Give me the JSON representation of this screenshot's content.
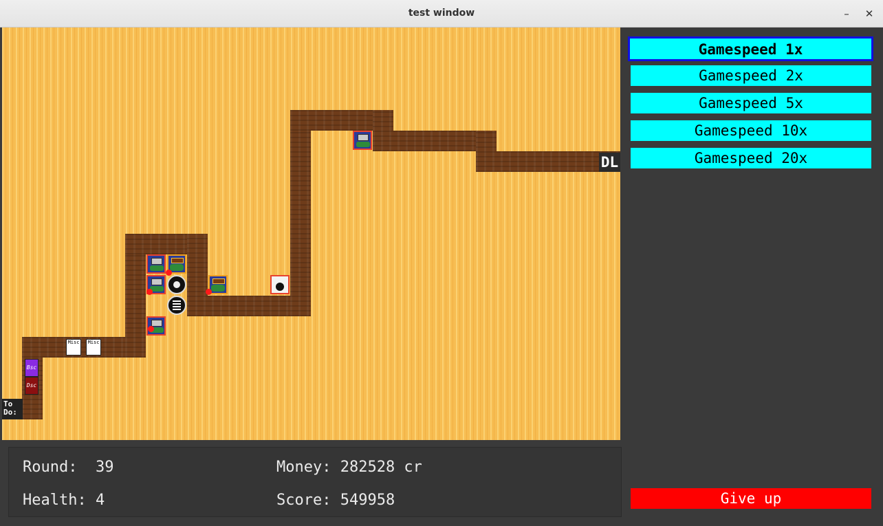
{
  "window": {
    "title": "test window",
    "minimize_glyph": "–",
    "close_glyph": "✕"
  },
  "board": {
    "start_label": "To\nDo:",
    "end_label": "DL",
    "paper_label": "Misc",
    "book_labels": [
      "Bsc",
      "Dsc"
    ]
  },
  "speed_buttons": [
    {
      "label": "Gamespeed 1x",
      "selected": true
    },
    {
      "label": "Gamespeed 2x",
      "selected": false
    },
    {
      "label": "Gamespeed 5x",
      "selected": false
    },
    {
      "label": "Gamespeed 10x",
      "selected": false
    },
    {
      "label": "Gamespeed 20x",
      "selected": false
    }
  ],
  "give_up_label": "Give up",
  "stats": {
    "round": "Round:  39",
    "health": "Health: 4",
    "money": "Money: 282528 cr",
    "score": "Score: 549958"
  },
  "colors": {
    "speed_button": "#00ffff",
    "selected_border": "#1010e0",
    "give_up": "#ff0000",
    "board_wood": "#f7bd52",
    "path_wood": "#6e3c1a"
  }
}
